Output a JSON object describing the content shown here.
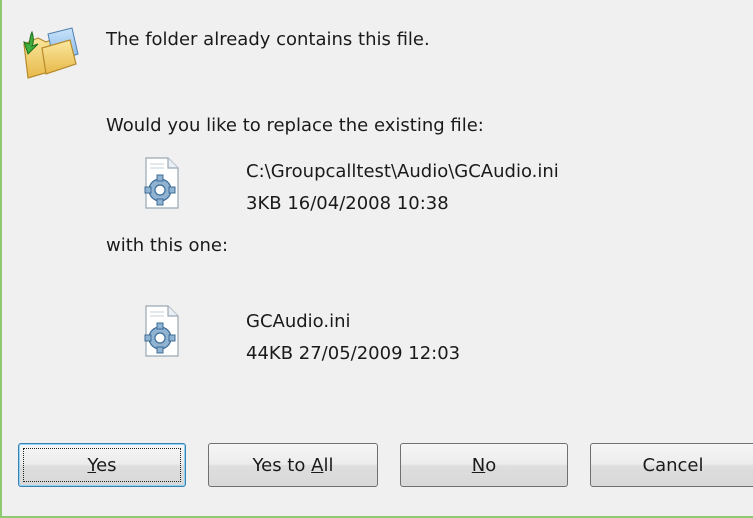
{
  "dialog": {
    "message": "The folder already contains this file.",
    "question": "Would you like to replace the existing file:",
    "existing_file": {
      "path": "C:\\Groupcalltest\\Audio\\GCAudio.ini",
      "info": "3KB  16/04/2008  10:38"
    },
    "with_label": "with this one:",
    "new_file": {
      "name": "GCAudio.ini",
      "info": "44KB  27/05/2009  12:03"
    },
    "icons": {
      "header": "folder-replace-icon",
      "existing": "settings-file-icon",
      "new": "settings-file-icon"
    }
  },
  "buttons": {
    "yes": {
      "mnemonic": "Y",
      "rest": "es"
    },
    "yes_to_all": {
      "prefix": "Yes to ",
      "mnemonic": "A",
      "rest": "ll"
    },
    "no": {
      "mnemonic": "N",
      "rest": "o"
    },
    "cancel": {
      "label": "Cancel"
    }
  },
  "colors": {
    "background": "#f0f0f0",
    "border_accent": "#8fca70",
    "default_button_border": "#3c7fb1"
  }
}
